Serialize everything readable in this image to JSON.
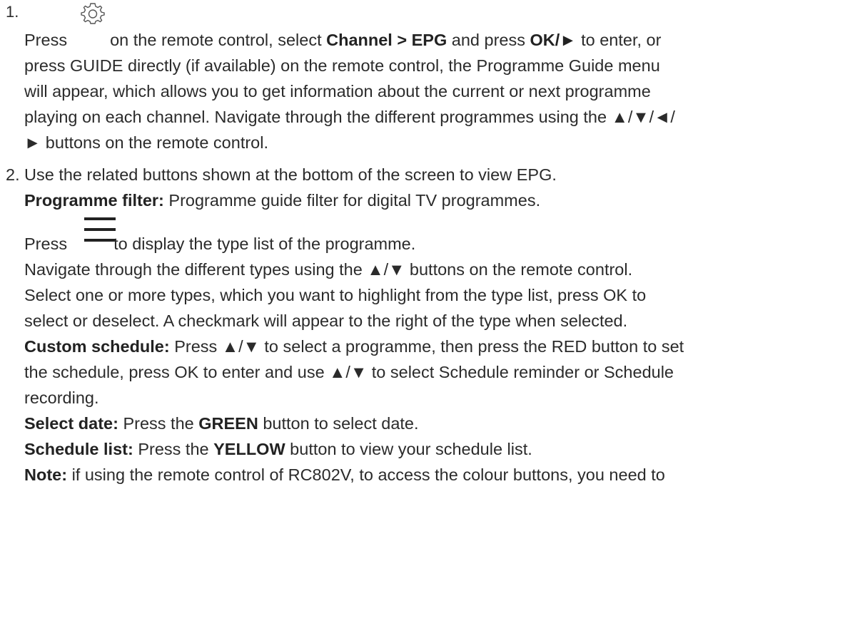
{
  "step1": {
    "number": "1.",
    "press": "Press",
    "icon": "gear-icon",
    "l1a": "on the remote control, select ",
    "l1b": "Channel > EPG",
    "l1c": " and press ",
    "l1d": "OK/►",
    "l1e": " to enter, or",
    "l2": "press GUIDE directly (if available) on the remote control, the Programme Guide menu",
    "l3": "will appear, which allows you to get information about the current or next programme",
    "l4": "playing on each channel. Navigate through the different programmes using the ▲/▼/◄/",
    "l5": "► buttons on the remote control."
  },
  "step2": {
    "number": "2.",
    "l1": "Use the related buttons shown at the bottom of the screen to view EPG.",
    "filter_label": "Programme filter:",
    "filter_text": " Programme guide filter for digital TV programmes.",
    "press": "Press",
    "icon": "menu-icon",
    "press_text": "to display the type list of the programme.",
    "l5": "Navigate through the different types using the ▲/▼ buttons on the remote control.",
    "l6": "Select one or more types, which you want to highlight from the type list, press OK to",
    "l7": "select or deselect. A checkmark will appear to the right of the type when selected.",
    "custom_label": "Custom schedule:",
    "custom_text": " Press ▲/▼ to select a programme, then press the RED button to set",
    "l9": "the schedule, press OK to enter and use ▲/▼ to select Schedule reminder or Schedule",
    "l10": "recording.",
    "date_label": "Select date:",
    "date_a": " Press the ",
    "date_b": "GREEN",
    "date_c": " button to select date.",
    "list_label": "Schedule list:",
    "list_a": " Press the ",
    "list_b": "YELLOW",
    "list_c": " button to view your schedule list.",
    "note_label": "Note:",
    "note_text": " if using the remote control of RC802V, to access the colour buttons, you need to"
  }
}
